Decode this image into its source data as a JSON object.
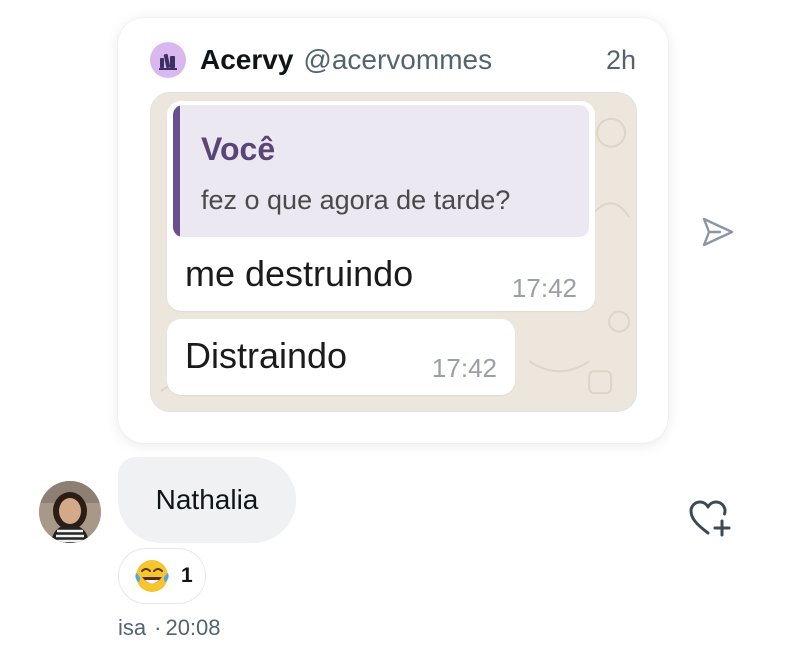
{
  "shared_post": {
    "author_name": "Acervy",
    "author_handle": "@acervommes",
    "time": "2h",
    "media": {
      "quoted_author": "Você",
      "quoted_text": "fez o que agora de tarde?",
      "message1_text": "me destruindo",
      "message1_time": "17:42",
      "message2_text": "Distraindo",
      "message2_time": "17:42"
    }
  },
  "icons": {
    "share": "paper-plane-icon",
    "like": "heart-plus-icon",
    "reaction": "face-with-tears-of-joy"
  },
  "reply": {
    "text": "Nathalia",
    "reaction_count": "1",
    "sender": "isa",
    "separator": "·",
    "time": "20:08"
  },
  "colors": {
    "quote_accent": "#6a4f8e",
    "bubble_bg": "#eff1f3",
    "muted_text": "#536471"
  }
}
